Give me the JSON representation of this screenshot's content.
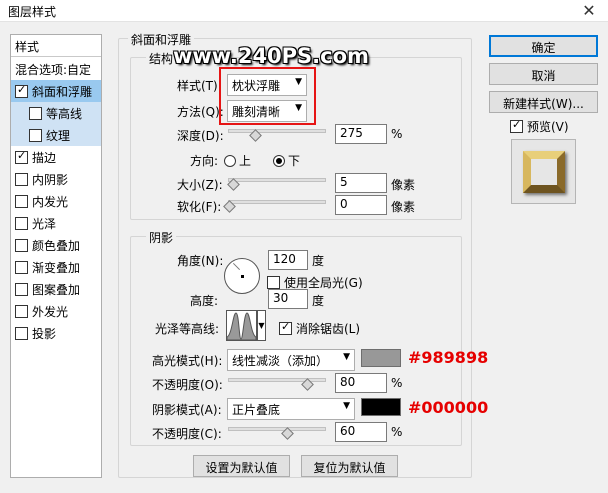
{
  "window": {
    "title": "图层样式",
    "close": "✕"
  },
  "watermark": "www.240PS.com",
  "left_panel": {
    "header": "样式",
    "items": [
      {
        "label": "混合选项:自定",
        "checkbox": false,
        "checked": false,
        "selected": false,
        "sub": false
      },
      {
        "label": "斜面和浮雕",
        "checkbox": true,
        "checked": true,
        "selected": true,
        "sub": false
      },
      {
        "label": "等高线",
        "checkbox": true,
        "checked": false,
        "selected": false,
        "sub": true
      },
      {
        "label": "纹理",
        "checkbox": true,
        "checked": false,
        "selected": false,
        "sub": true
      },
      {
        "label": "描边",
        "checkbox": true,
        "checked": true,
        "selected": false,
        "sub": false
      },
      {
        "label": "内阴影",
        "checkbox": true,
        "checked": false,
        "selected": false,
        "sub": false
      },
      {
        "label": "内发光",
        "checkbox": true,
        "checked": false,
        "selected": false,
        "sub": false
      },
      {
        "label": "光泽",
        "checkbox": true,
        "checked": false,
        "selected": false,
        "sub": false
      },
      {
        "label": "颜色叠加",
        "checkbox": true,
        "checked": false,
        "selected": false,
        "sub": false
      },
      {
        "label": "渐变叠加",
        "checkbox": true,
        "checked": false,
        "selected": false,
        "sub": false
      },
      {
        "label": "图案叠加",
        "checkbox": true,
        "checked": false,
        "selected": false,
        "sub": false
      },
      {
        "label": "外发光",
        "checkbox": true,
        "checked": false,
        "selected": false,
        "sub": false
      },
      {
        "label": "投影",
        "checkbox": true,
        "checked": false,
        "selected": false,
        "sub": false
      }
    ]
  },
  "bevel": {
    "group_title": "斜面和浮雕",
    "structure_title": "结构",
    "style_label": "样式(T):",
    "style_value": "枕状浮雕",
    "technique_label": "方法(Q):",
    "technique_value": "雕刻清晰",
    "depth_label": "深度(D):",
    "depth_value": "275",
    "depth_unit": "%",
    "depth_slider": 0.25,
    "direction_label": "方向:",
    "direction_up": "上",
    "direction_down": "下",
    "direction_selected": "下",
    "size_label": "大小(Z):",
    "size_value": "5",
    "size_unit": "像素",
    "size_slider": 0.03,
    "soften_label": "软化(F):",
    "soften_value": "0",
    "soften_unit": "像素",
    "soften_slider": 0.0
  },
  "shading": {
    "group_title": "阴影",
    "angle_label": "角度(N):",
    "angle_value": "120",
    "angle_unit": "度",
    "global_light_label": "使用全局光(G)",
    "global_light_checked": false,
    "altitude_label": "高度:",
    "altitude_value": "30",
    "altitude_unit": "度",
    "gloss_label": "光泽等高线:",
    "antialias_label": "消除锯齿(L)",
    "antialias_checked": true,
    "highlight_label": "高光模式(H):",
    "highlight_mode": "线性减淡（添加）",
    "highlight_color": "#989898",
    "highlight_hex": "#989898",
    "highlight_opacity_label": "不透明度(O):",
    "highlight_opacity": "80",
    "highlight_opacity_slider": 0.8,
    "shadow_label": "阴影模式(A):",
    "shadow_mode": "正片叠底",
    "shadow_color": "#000000",
    "shadow_hex": "#000000",
    "shadow_opacity_label": "不透明度(C):",
    "shadow_opacity": "60",
    "shadow_opacity_slider": 0.6,
    "opacity_unit": "%"
  },
  "bottom_buttons": {
    "make_default": "设置为默认值",
    "reset_default": "复位为默认值"
  },
  "right_panel": {
    "ok": "确定",
    "cancel": "取消",
    "new_style": "新建样式(W)...",
    "preview_label": "预览(V)",
    "preview_checked": true
  }
}
